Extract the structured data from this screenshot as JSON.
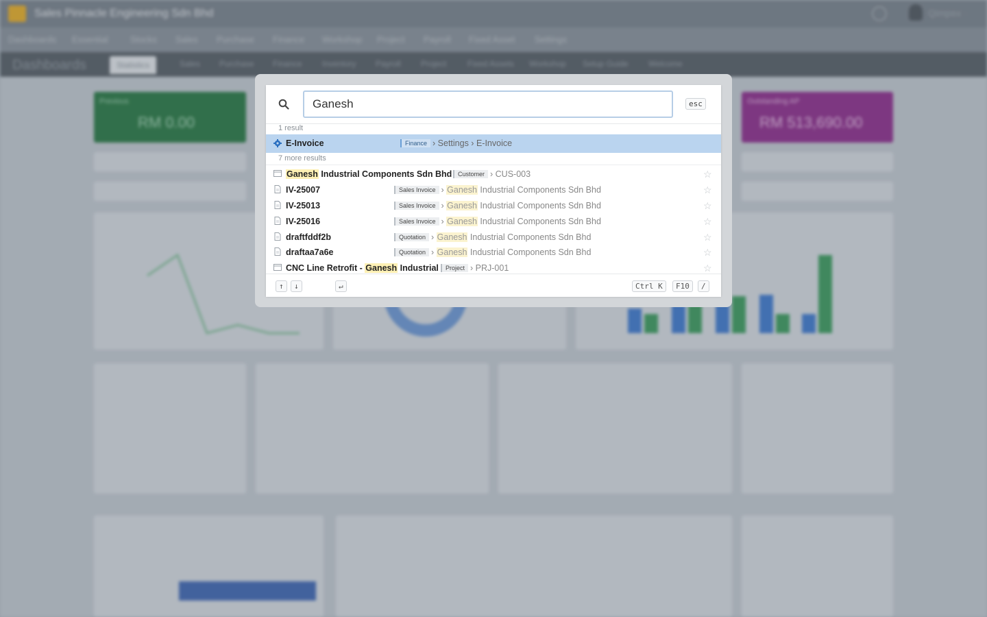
{
  "background": {
    "company": "Sales Pinnacle Engineering Sdn Bhd",
    "user": "Qimpex ·",
    "menu": [
      "Dashboards",
      "Essential",
      "Stocks",
      "Sales",
      "Purchase",
      "Finance",
      "Workshop",
      "Project",
      "Payroll",
      "Fixed Asset",
      "Settings"
    ],
    "dashboard_title": "Dashboards",
    "tabs": [
      "Statistics",
      "Sales",
      "Purchase",
      "Finance",
      "Inventory",
      "Payroll",
      "Project",
      "Fixed Assets",
      "Workshop",
      "Setup Guide",
      "Welcome"
    ],
    "cards": [
      {
        "label": "Previous",
        "value": "RM 0.00",
        "color": "#2a7a4a"
      },
      {
        "label": "Outstanding AP",
        "value": "RM 513,690.00",
        "color": "#8a2a8a"
      }
    ]
  },
  "palette": {
    "search_value": "Ganesh",
    "esc_label": "esc",
    "top_count": "1 result",
    "top_result": {
      "title": "E-Invoice",
      "tag": "Finance",
      "path": "› Settings › E-Invoice"
    },
    "more_count": "7 more results",
    "results": [
      {
        "pre": "",
        "hl": "Ganesh",
        "post": " Industrial Components Sdn Bhd",
        "tag": "Customer",
        "meta_pre": "› CUS-003",
        "meta_hl": "",
        "meta_post": "",
        "icon": "card",
        "tagx": 273
      },
      {
        "pre": "IV-25007",
        "hl": "",
        "post": "",
        "tag": "Sales Invoice",
        "meta_pre": "› ",
        "meta_hl": "Ganesh",
        "meta_post": " Industrial Components Sdn Bhd",
        "icon": "doc",
        "tagx": 187
      },
      {
        "pre": "IV-25013",
        "hl": "",
        "post": "",
        "tag": "Sales Invoice",
        "meta_pre": "› ",
        "meta_hl": "Ganesh",
        "meta_post": " Industrial Components Sdn Bhd",
        "icon": "doc",
        "tagx": 187
      },
      {
        "pre": "IV-25016",
        "hl": "",
        "post": "",
        "tag": "Sales Invoice",
        "meta_pre": "› ",
        "meta_hl": "Ganesh",
        "meta_post": " Industrial Components Sdn Bhd",
        "icon": "doc",
        "tagx": 187
      },
      {
        "pre": "draftfddf2b",
        "hl": "",
        "post": "",
        "tag": "Quotation",
        "meta_pre": "› ",
        "meta_hl": "Ganesh",
        "meta_post": " Industrial Components Sdn Bhd",
        "icon": "doc",
        "tagx": 187
      },
      {
        "pre": "draftaa7a6e",
        "hl": "",
        "post": "",
        "tag": "Quotation",
        "meta_pre": "› ",
        "meta_hl": "Ganesh",
        "meta_post": " Industrial Components Sdn Bhd",
        "icon": "doc",
        "tagx": 187
      },
      {
        "pre": "CNC Line Retrofit - ",
        "hl": "Ganesh",
        "post": " Industrial",
        "tag": "Project",
        "meta_pre": "› PRJ-001",
        "meta_hl": "",
        "meta_post": "",
        "icon": "card",
        "tagx": 255
      }
    ],
    "footer": {
      "up": "↑",
      "down": "↓",
      "enter": "↵",
      "shortcut1": "Ctrl K",
      "shortcut2": "F10",
      "shortcut3": "/"
    }
  }
}
